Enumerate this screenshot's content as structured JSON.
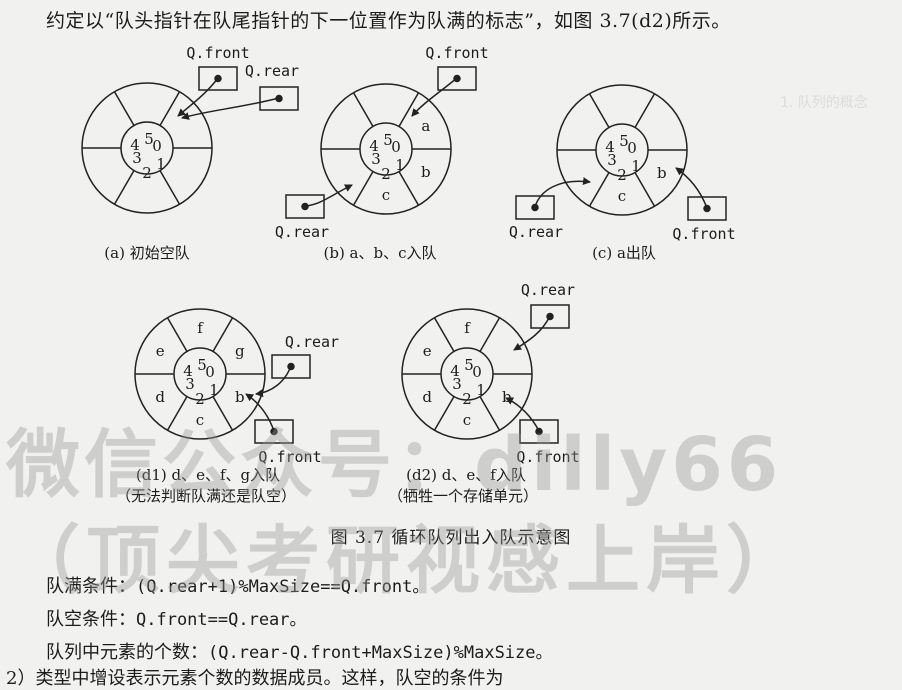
{
  "intro_text": "约定以“队头指针在队尾指针的下一位置作为队满的标志”，如图 3.7(d2)所示。",
  "figure_caption": "图 3.7   循环队列出入队示意图",
  "watermark": {
    "line1": "微信公众号：dilly66",
    "line2": "（顶尖考研视感上岸）"
  },
  "ptr_front": "Q.front",
  "ptr_rear": "Q.rear",
  "subfigures": {
    "a": {
      "label": "(a) 初始空队"
    },
    "b": {
      "label": "(b) a、b、c入队"
    },
    "c": {
      "label": "(c) a出队"
    },
    "d1": {
      "label": "(d1) d、e、f、g入队",
      "note": "（无法判断队满还是队空）"
    },
    "d2": {
      "label": "(d2) d、e、f入队",
      "note": "（牺牲一个存储单元）"
    }
  },
  "inner_indices": [
    "0",
    "1",
    "2",
    "3",
    "4",
    "5"
  ],
  "slot_values": {
    "b": {
      "a": "a",
      "b": "b",
      "c": "c"
    },
    "c": {
      "b": "b",
      "c": "c"
    },
    "d1": {
      "c": "c",
      "d": "d",
      "e": "e",
      "f": "f",
      "g": "g",
      "b": "b"
    },
    "d2": {
      "c": "c",
      "d": "d",
      "e": "e",
      "f": "f",
      "b": "b"
    }
  },
  "formulas": {
    "full_label": "队满条件：",
    "full_code": "(Q.rear+1)%MaxSize==Q.front。",
    "empty_label": "队空条件：",
    "empty_code": "Q.front==Q.rear。",
    "count_label": "队列中元素的个数：",
    "count_code": "(Q.rear-Q.front+MaxSize)%MaxSize。"
  },
  "bottom_fragment": "2）类型中增设表示元素个数的数据成员。这样，队空的条件为"
}
